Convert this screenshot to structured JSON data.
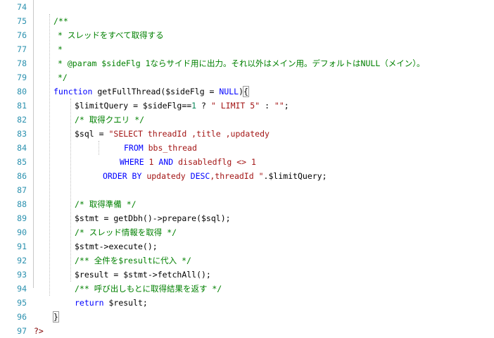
{
  "editor": {
    "line_numbers": [
      "74",
      "75",
      "76",
      "77",
      "78",
      "79",
      "80",
      "81",
      "82",
      "83",
      "84",
      "85",
      "86",
      "87",
      "88",
      "89",
      "90",
      "91",
      "92",
      "93",
      "94",
      "95",
      "96",
      "97"
    ],
    "lines": [
      {
        "indent": 0,
        "tokens": []
      },
      {
        "indent": 28,
        "tokens": [
          {
            "t": "/**",
            "c": "cmt"
          }
        ]
      },
      {
        "indent": 34,
        "tokens": [
          {
            "t": "* スレッドをすべて取得する",
            "c": "cmt"
          }
        ]
      },
      {
        "indent": 34,
        "tokens": [
          {
            "t": "*",
            "c": "cmt"
          }
        ]
      },
      {
        "indent": 34,
        "tokens": [
          {
            "t": "* @param $sideFlg 1ならサイド用に出力。それ以外はメイン用。デフォルトはNULL（メイン）。",
            "c": "cmt"
          }
        ]
      },
      {
        "indent": 34,
        "tokens": [
          {
            "t": "*/",
            "c": "cmt"
          }
        ]
      },
      {
        "indent": 28,
        "tokens": [
          {
            "t": "function",
            "c": "kw"
          },
          {
            "t": " getFullThread($sideFlg = "
          },
          {
            "t": "NULL",
            "c": "kw"
          },
          {
            "t": ")"
          },
          {
            "t": "{",
            "c": "box"
          }
        ]
      },
      {
        "indent": 58,
        "tokens": [
          {
            "t": "$limitQuery = $sideFlg=="
          },
          {
            "t": "1",
            "c": "num"
          },
          {
            "t": " ? "
          },
          {
            "t": "\" LIMIT 5\"",
            "c": "str"
          },
          {
            "t": " : "
          },
          {
            "t": "\"\"",
            "c": "str"
          },
          {
            "t": ";"
          }
        ]
      },
      {
        "indent": 58,
        "tokens": [
          {
            "t": "/* 取得クエリ */",
            "c": "cmt"
          }
        ]
      },
      {
        "indent": 58,
        "tokens": [
          {
            "t": "$sql = "
          },
          {
            "t": "\"SELECT threadId ,title ,updatedy",
            "c": "str"
          }
        ]
      },
      {
        "indent": 128,
        "tokens": [
          {
            "t": "FROM",
            "c": "kw"
          },
          {
            "t": " bbs_thread",
            "c": "str"
          }
        ]
      },
      {
        "indent": 122,
        "tokens": [
          {
            "t": "WHERE",
            "c": "kw"
          },
          {
            "t": " 1 ",
            "c": "str"
          },
          {
            "t": "AND",
            "c": "kw"
          },
          {
            "t": " disabledflg <> 1",
            "c": "str"
          }
        ]
      },
      {
        "indent": 98,
        "tokens": [
          {
            "t": "ORDER BY",
            "c": "kw"
          },
          {
            "t": " updatedy ",
            "c": "str"
          },
          {
            "t": "DESC",
            "c": "kw"
          },
          {
            "t": ",threadId \"",
            "c": "str"
          },
          {
            "t": ".$limitQuery;"
          }
        ]
      },
      {
        "indent": 0,
        "tokens": []
      },
      {
        "indent": 58,
        "tokens": [
          {
            "t": "/* 取得準備 */",
            "c": "cmt"
          }
        ]
      },
      {
        "indent": 58,
        "tokens": [
          {
            "t": "$stmt = getDbh()->prepare($sql);"
          }
        ]
      },
      {
        "indent": 58,
        "tokens": [
          {
            "t": "/* スレッド情報を取得 */",
            "c": "cmt"
          }
        ]
      },
      {
        "indent": 58,
        "tokens": [
          {
            "t": "$stmt->execute();"
          }
        ]
      },
      {
        "indent": 58,
        "tokens": [
          {
            "t": "/** 全件を$resultに代入 */",
            "c": "cmt"
          }
        ]
      },
      {
        "indent": 58,
        "tokens": [
          {
            "t": "$result = $stmt->fetchAll();"
          }
        ]
      },
      {
        "indent": 58,
        "tokens": [
          {
            "t": "/** 呼び出しもとに取得結果を返す */",
            "c": "cmt"
          }
        ]
      },
      {
        "indent": 58,
        "tokens": [
          {
            "t": "return",
            "c": "kw"
          },
          {
            "t": " $result;"
          }
        ]
      },
      {
        "indent": 28,
        "tokens": [
          {
            "t": "}",
            "c": "box"
          }
        ]
      },
      {
        "indent": 0,
        "tokens": [
          {
            "t": "?>",
            "c": "tag"
          }
        ]
      }
    ]
  }
}
